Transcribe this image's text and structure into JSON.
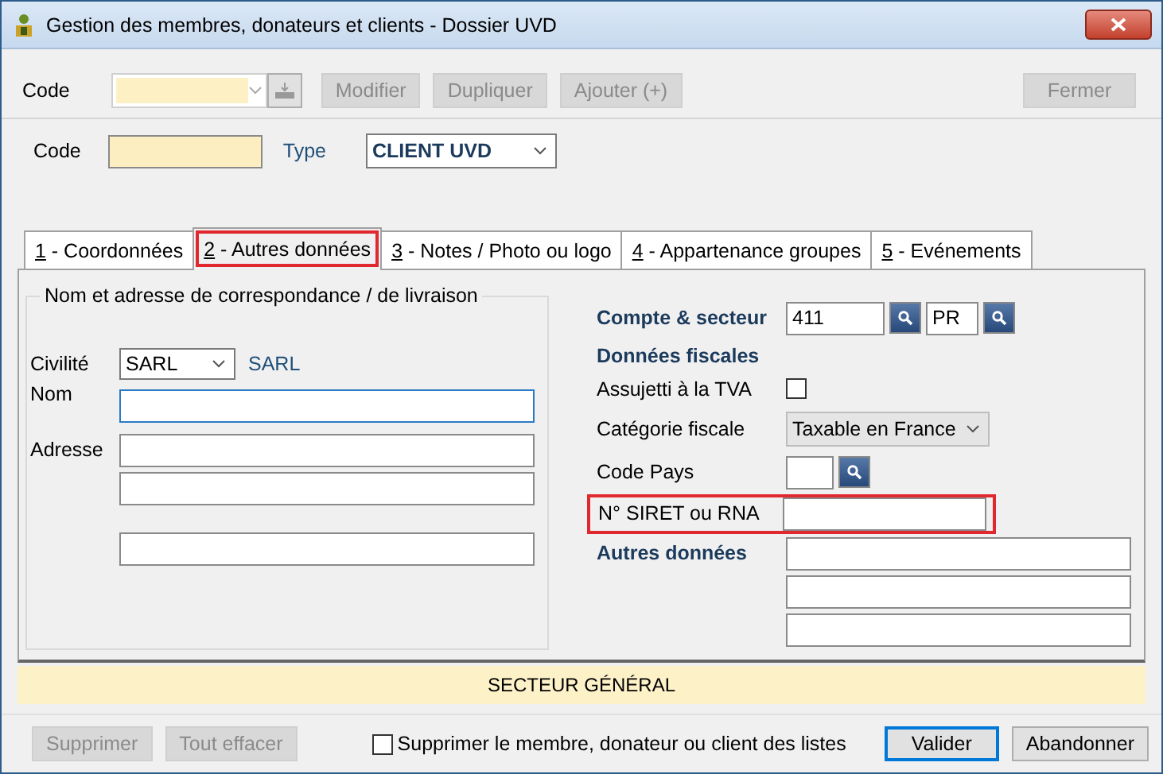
{
  "window": {
    "title": "Gestion des membres, donateurs et clients - Dossier UVD"
  },
  "toolbar": {
    "code_label": "Code",
    "buttons": [
      {
        "label": "Modifier",
        "disabled": true
      },
      {
        "label": "Dupliquer",
        "disabled": true
      },
      {
        "label": "Ajouter (+)",
        "disabled": true
      }
    ],
    "close_button": {
      "label": "Fermer",
      "disabled": true
    }
  },
  "header": {
    "code_label": "Code",
    "type_label": "Type",
    "type_value": "CLIENT UVD"
  },
  "tabs": [
    {
      "key": "1",
      "label": " - Coordonnées",
      "selected": false,
      "highlighted": false
    },
    {
      "key": "2",
      "label": " - Autres données",
      "selected": true,
      "highlighted": true
    },
    {
      "key": "3",
      "label": " - Notes / Photo ou logo",
      "selected": false,
      "highlighted": false
    },
    {
      "key": "4",
      "label": " - Appartenance groupes",
      "selected": false,
      "highlighted": false
    },
    {
      "key": "5",
      "label": " - Evénements",
      "selected": false,
      "highlighted": false
    }
  ],
  "address_group": {
    "title": "Nom et adresse de correspondance / de livraison",
    "civility_label": "Civilité",
    "civility_value": "SARL",
    "civility_text": "SARL",
    "name_label": "Nom",
    "address_label": "Adresse"
  },
  "fiscal": {
    "account_label": "Compte & secteur",
    "account": "411",
    "sector": "PR",
    "fiscal_heading": "Données fiscales",
    "vat_label": "Assujetti à la TVA",
    "vat_checked": false,
    "category_label": "Catégorie fiscale",
    "category_value": "Taxable en France",
    "country_label": "Code Pays",
    "siret_label": "N° SIRET ou RNA",
    "siret_highlighted": true,
    "other_heading": "Autres données"
  },
  "status_bar": "SECTEUR GÉNÉRAL",
  "footer": {
    "buttons": [
      {
        "label": "Supprimer",
        "disabled": true
      },
      {
        "label": "Tout effacer",
        "disabled": true
      }
    ],
    "remove_label": "Supprimer le membre, donateur ou client des listes",
    "remove_checked": false,
    "actions": [
      {
        "label": "Valider",
        "default": true
      },
      {
        "label": "Abandonner",
        "default": false
      }
    ]
  }
}
